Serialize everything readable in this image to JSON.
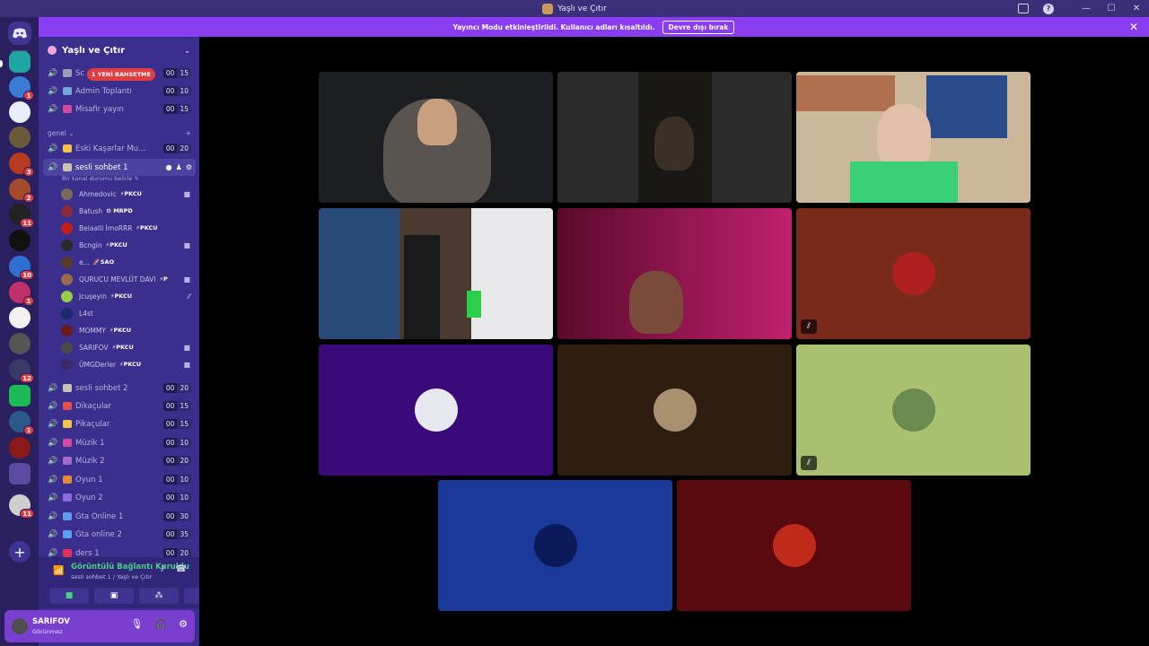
{
  "window": {
    "title": "Yaşlı ve Çıtır"
  },
  "banner": {
    "text": "Yayıncı Modu etkinleştirildi. Kullanıcı adları kısaltıldı.",
    "button": "Devre dışı bırak",
    "close": "✕"
  },
  "guilds": {
    "badges": [
      "1",
      "3",
      "2",
      "11",
      "10",
      "1",
      "12",
      "1",
      "11"
    ]
  },
  "server": {
    "name": "Yaşlı ve Çıtır"
  },
  "top_channels": [
    {
      "name": "Sc",
      "c1": "00",
      "c2": "15"
    },
    {
      "name": "Admin Toplantı",
      "c1": "00",
      "c2": "10"
    },
    {
      "name": "Misafir yayın",
      "c1": "00",
      "c2": "15"
    }
  ],
  "mention_badge": "1 YENİ BAHSETME",
  "category": "genel",
  "channels_mid": [
    {
      "name": "Eski Kaşarlar Mu...",
      "c1": "00",
      "c2": "20"
    }
  ],
  "active_channel": {
    "name": "sesli sohbet 1",
    "status": "Bir kanal durumu belirle"
  },
  "voice_users": [
    {
      "name": "Ahmedovic",
      "tag": "⚡PKCU"
    },
    {
      "name": "Batush",
      "tag": "⚙ MRPD"
    },
    {
      "name": "Belaalli İmoRRR",
      "tag": "⚡PKCU"
    },
    {
      "name": "Bcngin",
      "tag": "⚡PKCU"
    },
    {
      "name": "e...",
      "tag": "🚀SAO"
    },
    {
      "name": "QURUCU MEVLÜT DAVI",
      "tag": "⚡P"
    },
    {
      "name": "Jcuşeyin",
      "tag": "⚡PKCU"
    },
    {
      "name": "L4st",
      "tag": ""
    },
    {
      "name": "MOMMY",
      "tag": "⚡PKCU"
    },
    {
      "name": "SARIFOV",
      "tag": "⚡PKCU"
    },
    {
      "name": "ÜMGDerler",
      "tag": "⚡PKCU"
    }
  ],
  "channels_bottom": [
    {
      "name": "sesli sohbet 2",
      "c1": "00",
      "c2": "20"
    },
    {
      "name": "Dikaçular",
      "c1": "00",
      "c2": "15"
    },
    {
      "name": "Pikaçular",
      "c1": "00",
      "c2": "15"
    },
    {
      "name": "Müzik 1",
      "c1": "00",
      "c2": "10"
    },
    {
      "name": "Müzik 2",
      "c1": "00",
      "c2": "20"
    },
    {
      "name": "Oyun 1",
      "c1": "00",
      "c2": "10"
    },
    {
      "name": "Oyun 2",
      "c1": "00",
      "c2": "10"
    },
    {
      "name": "Gta Online 1",
      "c1": "00",
      "c2": "30"
    },
    {
      "name": "Gta online 2",
      "c1": "00",
      "c2": "35"
    },
    {
      "name": "ders 1",
      "c1": "00",
      "c2": "20"
    }
  ],
  "voice_panel": {
    "title": "Görüntülü Bağlantı Kuruldu",
    "subtitle": "sesli sohbet 1 / Yaşlı ve Çıtır"
  },
  "user": {
    "name": "SARIFOV",
    "status": "Görünmez"
  },
  "colors": {
    "titlebar": "#3b2f7a",
    "sidebar": "#3a2f8c",
    "banner": "#8a3cf0",
    "user_panel": "#7b3fcf",
    "connected_green": "#49d084",
    "mention_red": "#e03d43"
  }
}
